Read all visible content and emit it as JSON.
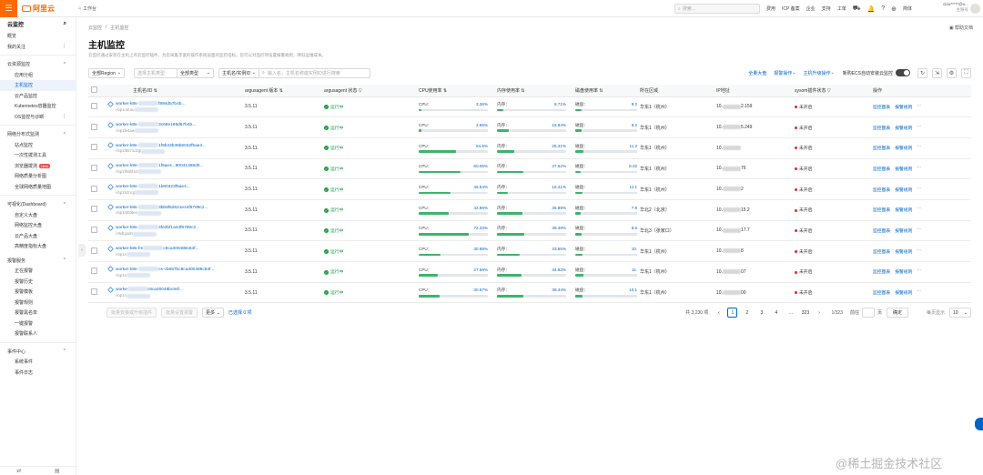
{
  "topbar": {
    "logo": "阿里云",
    "workbench": "工作台",
    "search_placeholder": "搜索...",
    "nav": [
      "费用",
      "ICP 备案",
      "企业",
      "支持",
      "工单"
    ],
    "lang": "简体",
    "account": "clou*****@o...",
    "account_sub": "主账号"
  },
  "sidebar": {
    "title": "云监控",
    "items": [
      {
        "label": "概览",
        "type": "item"
      },
      {
        "label": "我的关注",
        "type": "item",
        "more": true
      },
      {
        "type": "sep"
      },
      {
        "label": "云资源监控",
        "type": "group"
      },
      {
        "label": "应用分组",
        "type": "sub"
      },
      {
        "label": "主机监控",
        "type": "sub",
        "active": true
      },
      {
        "label": "云产品监控",
        "type": "sub"
      },
      {
        "label": "Kubernetes容器监控",
        "type": "sub"
      },
      {
        "label": "OS监控与诊断",
        "type": "sub",
        "more": true
      },
      {
        "type": "sep"
      },
      {
        "label": "网络分布式监测",
        "type": "group"
      },
      {
        "label": "站点监控",
        "type": "sub"
      },
      {
        "label": "一次性拨测工具",
        "type": "sub"
      },
      {
        "label": "浏览器拨测",
        "type": "sub",
        "badge": "New"
      },
      {
        "label": "网络质量分析图",
        "type": "sub"
      },
      {
        "label": "全球网络质量地图",
        "type": "sub"
      },
      {
        "type": "sep"
      },
      {
        "label": "可视化(Dashboard)",
        "type": "group"
      },
      {
        "label": "自定义大盘",
        "type": "sub"
      },
      {
        "label": "网络监控大盘",
        "type": "sub"
      },
      {
        "label": "云产品大盘",
        "type": "sub"
      },
      {
        "label": "高精度指标大盘",
        "type": "sub"
      },
      {
        "label": "报警服务",
        "type": "group"
      },
      {
        "label": "正在报警",
        "type": "sub"
      },
      {
        "label": "报警历史",
        "type": "sub"
      },
      {
        "label": "报警模板",
        "type": "sub"
      },
      {
        "label": "报警规则",
        "type": "sub"
      },
      {
        "label": "报警黑名单",
        "type": "sub"
      },
      {
        "label": "一键报警",
        "type": "sub"
      },
      {
        "label": "报警联系人",
        "type": "sub"
      },
      {
        "type": "sep"
      },
      {
        "label": "事件中心",
        "type": "group"
      },
      {
        "label": "系统事件",
        "type": "sub"
      },
      {
        "label": "事件日志",
        "type": "sub"
      }
    ]
  },
  "main": {
    "breadcrumb": [
      "云监控",
      "主机监控"
    ],
    "help": "帮助文档",
    "title": "主机监控",
    "desc": "云监控通过安装在主机上的云监控插件，为您采集丰富的操作系统层面的监控指标。您可以对监控项设置报警规则，降低运维成本。",
    "toolbar": {
      "region": "全部Region",
      "group_placeholder": "选择主机类型",
      "host_type": "全部类型",
      "name_filter": "主机名/实例ID",
      "search_placeholder": "输入名，主机名称或实例ID进行搜索",
      "links": [
        "全量大盘",
        "报警操作",
        "主机升级操作"
      ],
      "toggle_label": "新购ECS自动安装云监控"
    },
    "columns": [
      "主机名/ID",
      "argusagent 版本",
      "argusagent 状态",
      "CPU使用率",
      "内存使用率",
      "磁盘使用率",
      "所在区域",
      "IP地址",
      "sysom插件状态",
      "操作"
    ],
    "rows": [
      {
        "name": "worker-k8s-",
        "name_tail": "f894d57b4b...",
        "id": "i-bp1ckl.su",
        "ver": "3.5.11",
        "status": "运行中",
        "cpu": "3.36%",
        "cpu_v": 0.0336,
        "mem": "8.71%",
        "mem_v": 0.0871,
        "disk": "9.24 %",
        "disk_v": 0.0924,
        "region": "华东1（杭州）",
        "ip_head": "10.",
        "ip_tail": "2.159",
        "sysom": "未开启",
        "op1": "监控图表",
        "op2": "报警规则"
      },
      {
        "name": "worker-k8s-",
        "name_tail": "3c68e189d57b4b...",
        "id": "i-bp1fe4aw",
        "ver": "3.5.11",
        "status": "运行中",
        "cpu": "3.65%",
        "cpu_v": 0.0365,
        "mem": "16.84%",
        "mem_v": 0.1684,
        "disk": "9.26 %",
        "disk_v": 0.0926,
        "region": "华东1（杭州）",
        "ip_head": "10.",
        "ip_tail": "5.249",
        "sysom": "未开启",
        "op1": "监控图表",
        "op2": "报警规则"
      },
      {
        "name": "worker-k8s-",
        "name_tail": "1f9b43b36b6042f5ae4...",
        "id": "i-bp1f6571dzgl",
        "ver": "3.5.11",
        "status": "运行中",
        "cpu": "54.5%",
        "cpu_v": 0.545,
        "mem": "25.41%",
        "mem_v": 0.2541,
        "disk": "11.27 %",
        "disk_v": 0.1127,
        "region": "华东1（杭州）",
        "ip_head": "10.",
        "ip_tail": "",
        "sysom": "未开启",
        "op1": "监控图表",
        "op2": "报警规则"
      },
      {
        "name": "worker-k8s-",
        "name_tail": "1f5ae4...80041468d0...",
        "id": "i-bp1f0d6f10",
        "ver": "3.5.11",
        "status": "运行中",
        "cpu": "60.05%",
        "cpu_v": 0.6005,
        "mem": "37.52%",
        "mem_v": 0.3752,
        "disk": "8.029 %",
        "disk_v": 0.08029,
        "region": "华东1（杭州）",
        "ip_head": "10.",
        "ip_tail": "76",
        "sysom": "未开启",
        "op1": "监控图表",
        "op2": "报警规则"
      },
      {
        "name": "worker-k8s-",
        "name_tail": "1b60423f5ae4...",
        "id": "i-bp152ncg",
        "ver": "3.5.11",
        "status": "运行中",
        "cpu": "46.54%",
        "cpu_v": 0.4654,
        "mem": "16.41%",
        "mem_v": 0.1641,
        "disk": "11.17 %",
        "disk_v": 0.1117,
        "region": "华东1（杭州）",
        "ip_head": "10.",
        "ip_tail": "2",
        "sysom": "未开启",
        "op1": "监控图表",
        "op2": "报警规则"
      },
      {
        "name": "worker-k8s-",
        "name_tail": "3bb9f62621e44f6789c2...",
        "id": "i-bp1ht0dtee",
        "ver": "3.5.11",
        "status": "运行中",
        "cpu": "42.96%",
        "cpu_v": 0.4296,
        "mem": "36.89%",
        "mem_v": 0.3689,
        "disk": "7.99 %",
        "disk_v": 0.0799,
        "region": "华北2（北京）",
        "ip_head": "10.",
        "ip_tail": "15.2",
        "sysom": "未开启",
        "op1": "监控图表",
        "op2": "报警规则"
      },
      {
        "name": "worker-k8s-",
        "name_tail": "4fe2bf1a44f8789c2...",
        "id": "i-8vbgodrr",
        "ver": "3.5.11",
        "status": "运行中",
        "cpu": "72.33%",
        "cpu_v": 0.7233,
        "mem": "39.49%",
        "mem_v": 0.3949,
        "disk": "8.68 %",
        "disk_v": 0.0868,
        "region": "华北3（张家口）",
        "ip_head": "10.",
        "ip_tail": "17.7",
        "sysom": "未开启",
        "op1": "监控图表",
        "op2": "报警规则"
      },
      {
        "name": "worker-k8s-fm",
        "name_tail": "c8ca300488c84f...",
        "id": "i-bp1s",
        "ver": "3.5.11",
        "status": "运行中",
        "cpu": "30.98%",
        "cpu_v": 0.3098,
        "mem": "33.55%",
        "mem_v": 0.3355,
        "disk": "10.4 %",
        "disk_v": 0.104,
        "region": "华东1（杭州）",
        "ip_head": "10.",
        "ip_tail": "8",
        "sysom": "未开启",
        "op1": "监控图表",
        "op2": "报警规则"
      },
      {
        "name": "worker-k8s-",
        "name_tail": "cs-cb657bc8ca300488c84f...",
        "id": "i-bp1s",
        "ver": "3.5.11",
        "status": "运行中",
        "cpu": "27.69%",
        "cpu_v": 0.2769,
        "mem": "34.93%",
        "mem_v": 0.3493,
        "disk": "11.7 %",
        "disk_v": 0.117,
        "region": "华东1（杭州）",
        "ip_head": "10.",
        "ip_tail": "07",
        "sysom": "未开启",
        "op1": "监控图表",
        "op2": "报警规则"
      },
      {
        "name": "worke",
        "name_tail": "c8ca30048bc84f...",
        "id": "i-bp1s",
        "ver": "3.5.11",
        "status": "运行中",
        "cpu": "30.57%",
        "cpu_v": 0.3057,
        "mem": "38.44%",
        "mem_v": 0.3844,
        "disk": "10.13 %",
        "disk_v": 0.1013,
        "region": "华东1（杭州）",
        "ip_head": "10.",
        "ip_tail": "00",
        "sysom": "未开启",
        "op1": "监控图表",
        "op2": "报警规则"
      }
    ],
    "footer": {
      "btn_batch_install": "批量安装或升级插件",
      "btn_batch_alarm": "批量设置报警",
      "more": "更多",
      "selected": "已选择 0 项",
      "total": "共 3,230 项",
      "pages": [
        "1",
        "2",
        "3",
        "4",
        "...",
        "323"
      ],
      "page_info": "1/323",
      "goto": "前往",
      "goto_unit": "页",
      "confirm": "确定",
      "per_page_label": "每页显示",
      "per_page": "10"
    },
    "cpu_label": "CPU：",
    "mem_label": "内存：",
    "disk_label": "磁盘："
  },
  "colors": {
    "accent": "#0064c8",
    "brand": "#ff6a00",
    "running": "#1a9c3e",
    "bar_fill": "#3bb56b",
    "bar_bg": "#e3e6ea",
    "off": "#d93026"
  },
  "watermark": "@稀土掘金技术社区"
}
